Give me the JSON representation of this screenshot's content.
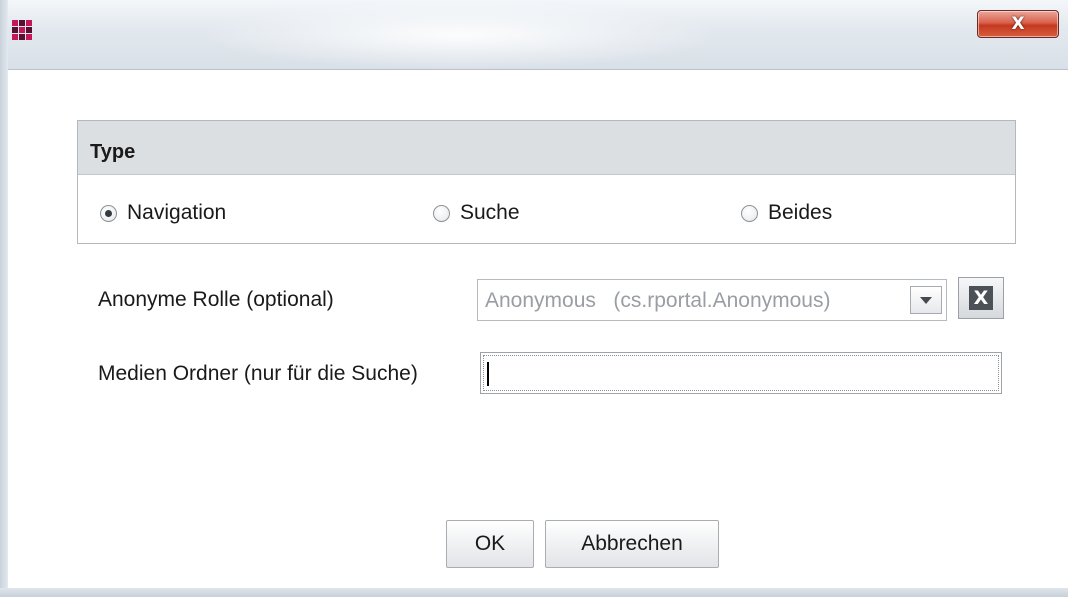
{
  "window": {
    "close_label": "X"
  },
  "type_group": {
    "title": "Type",
    "options": [
      {
        "label": "Navigation",
        "checked": true
      },
      {
        "label": "Suche",
        "checked": false
      },
      {
        "label": "Beides",
        "checked": false
      }
    ]
  },
  "form": {
    "role_label": "Anonyme Rolle (optional)",
    "role_value": "Anonymous   (cs.rportal.Anonymous)",
    "clear_label": "X",
    "media_label": "Medien Ordner (nur für die Suche)",
    "media_value": ""
  },
  "buttons": {
    "ok": "OK",
    "cancel": "Abbrechen"
  },
  "colors": {
    "accent_icon": "#8b1a4a",
    "close_red": "#c6391f",
    "group_header": "#dcdfe2"
  }
}
